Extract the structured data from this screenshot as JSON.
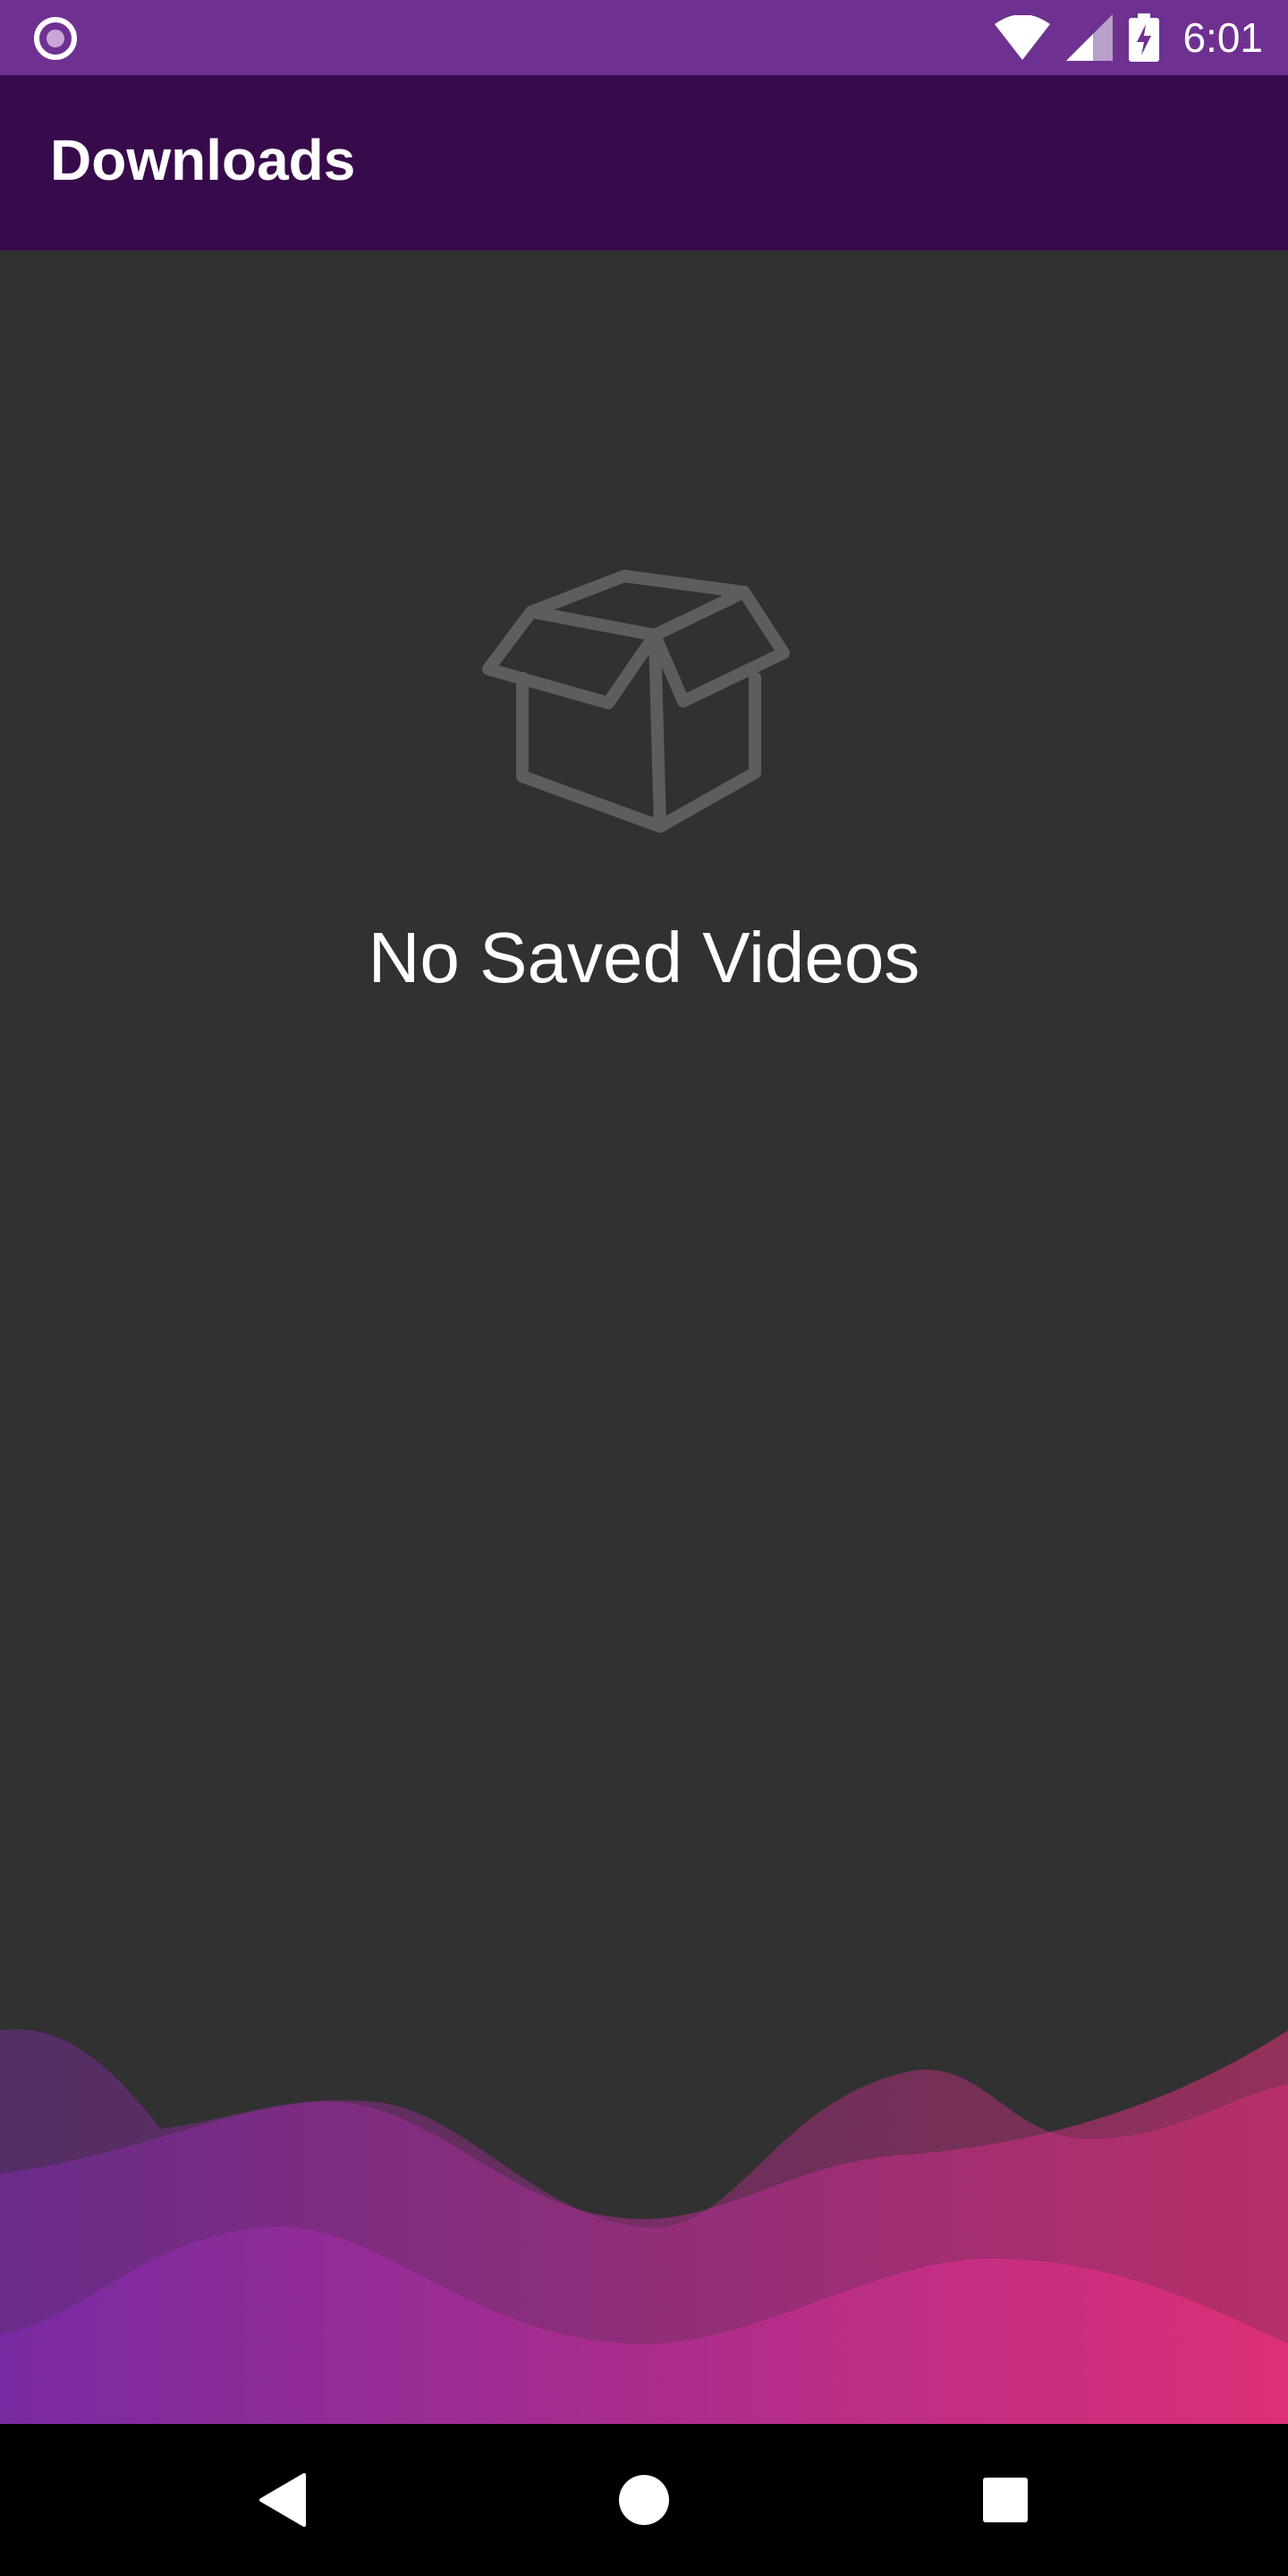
{
  "status_bar": {
    "time": "6:01",
    "left_icon": "record-indicator-icon",
    "wifi_icon": "wifi-icon",
    "signal_icon": "cell-signal-icon",
    "battery_icon": "battery-charging-icon",
    "background_color": "#6f3191"
  },
  "app_bar": {
    "title": "Downloads",
    "background_color": "#370a4b"
  },
  "empty_state": {
    "icon": "open-box-icon",
    "message": "No Saved Videos"
  },
  "nav_bar": {
    "back_icon": "back-triangle-icon",
    "home_icon": "home-circle-icon",
    "recents_icon": "recents-square-icon"
  },
  "colors": {
    "background": "#313131",
    "wave_start": "#7b2aa6",
    "wave_end": "#e32f7a"
  }
}
